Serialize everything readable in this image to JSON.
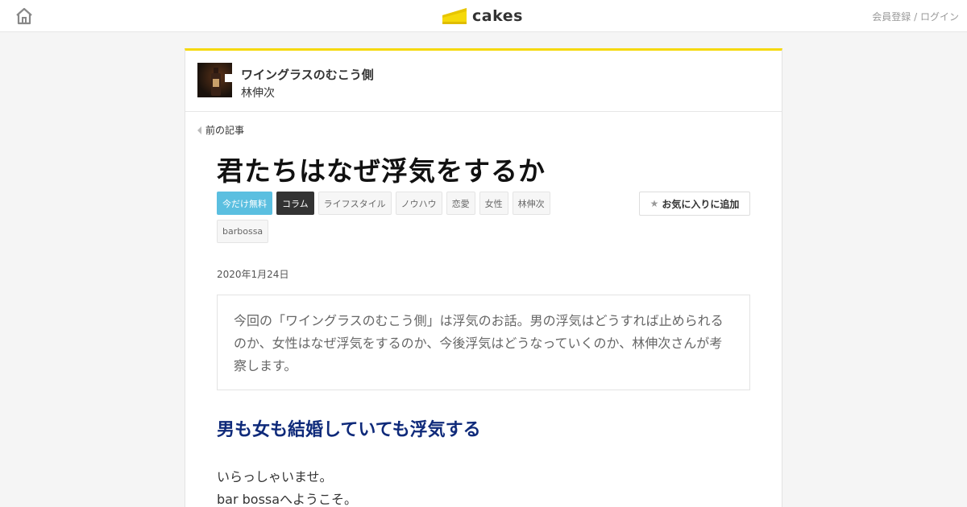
{
  "header": {
    "logo_text": "cakes",
    "auth_register": "会員登録",
    "auth_separator": " / ",
    "auth_login": "ログイン"
  },
  "series": {
    "title": "ワイングラスのむこう側",
    "author": "林伸次"
  },
  "nav": {
    "prev_label": "前の記事"
  },
  "article": {
    "title": "君たちはなぜ浮気をするか",
    "tags": [
      "今だけ無料",
      "コラム",
      "ライフスタイル",
      "ノウハウ",
      "恋愛",
      "女性",
      "林伸次",
      "barbossa"
    ],
    "favorite_label": "お気に入りに追加",
    "date": "2020年1月24日",
    "lead": "今回の「ワイングラスのむこう側」は浮気のお話。男の浮気はどうすれば止められるのか、女性はなぜ浮気をするのか、今後浮気はどうなっていくのか、林伸次さんが考察します。",
    "heading": "男も女も結婚していても浮気する",
    "paragraph_line1": "いらっしゃいませ。",
    "paragraph_line2": "bar bossaへようこそ。"
  },
  "colors": {
    "accent_yellow": "#f5d90a",
    "tag_free": "#5bbfe0",
    "tag_column": "#333333",
    "heading_blue": "#0f2a7a"
  },
  "icons": {
    "home": "home-icon",
    "logo": "cheesecake-logo-icon",
    "prev": "triangle-left-icon",
    "favorite": "star-icon"
  }
}
